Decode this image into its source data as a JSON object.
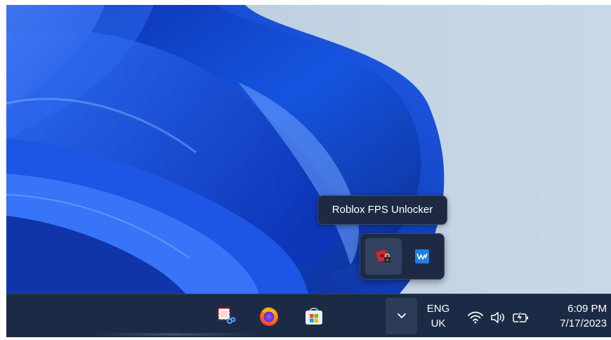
{
  "tooltip": {
    "text": "Roblox FPS Unlocker"
  },
  "overflow_tray": {
    "items": [
      {
        "name": "Roblox FPS Unlocker",
        "icon": "roblox-fps-unlocker-icon",
        "hovered": true
      },
      {
        "name": "Waves MaxxAudio",
        "icon": "waves-icon",
        "hovered": false
      }
    ]
  },
  "taskbar": {
    "apps": [
      {
        "icon": "snipping-tool-icon"
      },
      {
        "icon": "firefox-icon"
      },
      {
        "icon": "microsoft-store-icon"
      }
    ],
    "language": {
      "line1": "ENG",
      "line2": "UK"
    },
    "clock": {
      "time": "6:09 PM",
      "date": "7/17/2023"
    },
    "system_icons": [
      "wifi-icon",
      "speaker-icon",
      "battery-charging-icon"
    ]
  },
  "colors": {
    "taskbar": "#1c2b45",
    "wallpaper_background": "#c3d3e2",
    "bloom_blue": "#1a4fd6"
  }
}
